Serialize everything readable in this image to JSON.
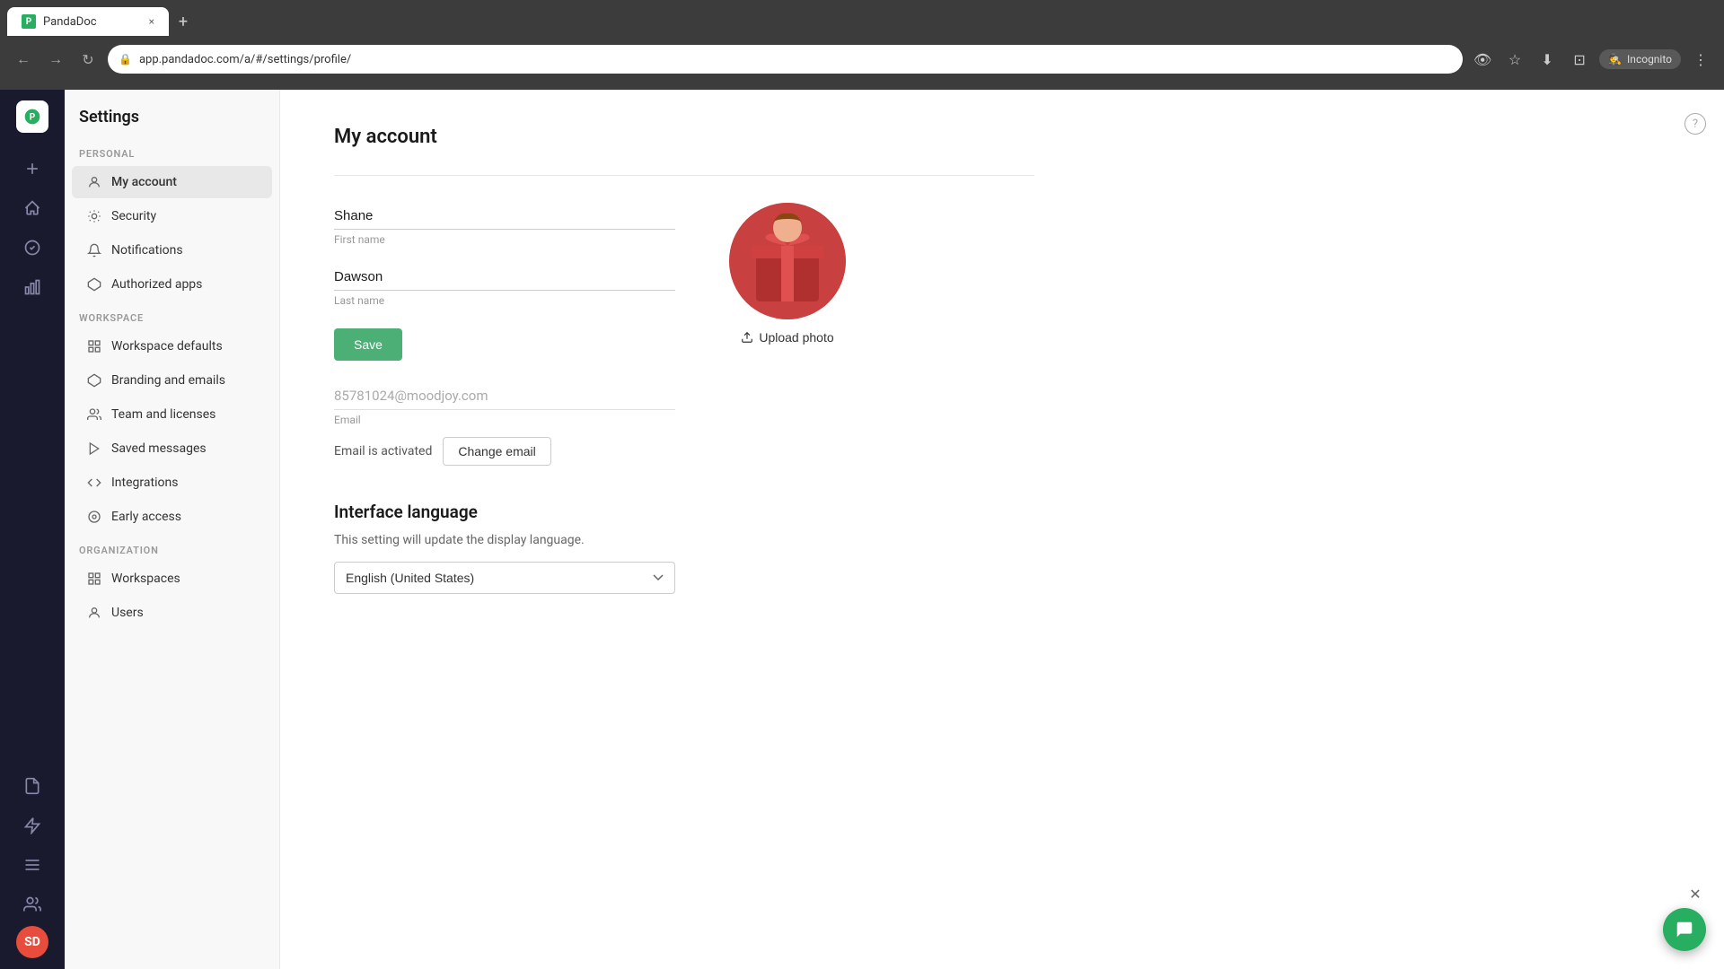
{
  "browser": {
    "tab_title": "PandaDoc",
    "tab_close": "×",
    "new_tab": "+",
    "back": "←",
    "forward": "→",
    "refresh": "↻",
    "url": "app.pandadoc.com/a/#/settings/profile/",
    "incognito_label": "Incognito"
  },
  "app_title": "Settings",
  "help_label": "?",
  "sidebar": {
    "personal_label": "PERSONAL",
    "workspace_label": "WORKSPACE",
    "organization_label": "ORGANIZATION",
    "items_personal": [
      {
        "id": "my-account",
        "label": "My account",
        "icon": "👤",
        "active": true
      },
      {
        "id": "security",
        "label": "Security",
        "icon": "🔒",
        "active": false
      },
      {
        "id": "notifications",
        "label": "Notifications",
        "icon": "🔔",
        "active": false
      },
      {
        "id": "authorized-apps",
        "label": "Authorized apps",
        "icon": "⬡",
        "active": false
      }
    ],
    "items_workspace": [
      {
        "id": "workspace-defaults",
        "label": "Workspace defaults",
        "icon": "⊞",
        "active": false
      },
      {
        "id": "branding-emails",
        "label": "Branding and emails",
        "icon": "⬡",
        "active": false
      },
      {
        "id": "team-licenses",
        "label": "Team and licenses",
        "icon": "👥",
        "active": false
      },
      {
        "id": "saved-messages",
        "label": "Saved messages",
        "icon": "▷",
        "active": false
      },
      {
        "id": "integrations",
        "label": "Integrations",
        "icon": "⟨⟩",
        "active": false
      },
      {
        "id": "early-access",
        "label": "Early access",
        "icon": "◎",
        "active": false
      }
    ],
    "items_organization": [
      {
        "id": "workspaces",
        "label": "Workspaces",
        "icon": "⊞",
        "active": false
      },
      {
        "id": "users",
        "label": "Users",
        "icon": "👤",
        "active": false
      }
    ]
  },
  "main": {
    "page_title": "My account",
    "first_name_value": "Shane",
    "first_name_label": "First name",
    "last_name_value": "Dawson",
    "last_name_label": "Last name",
    "save_button": "Save",
    "email_value": "85781024@moodjoy.com",
    "email_label": "Email",
    "email_status": "Email is activated",
    "change_email_button": "Change email",
    "upload_photo_button": "Upload photo",
    "interface_language_title": "Interface language",
    "interface_language_desc": "This setting will update the display language.",
    "language_value": "English (United States)"
  },
  "rail": {
    "add_icon": "+",
    "home_icon": "⌂",
    "check_icon": "✓",
    "chart_icon": "📊",
    "doc_icon": "📄",
    "lightning_icon": "⚡",
    "list_icon": "☰",
    "people_icon": "👥"
  }
}
